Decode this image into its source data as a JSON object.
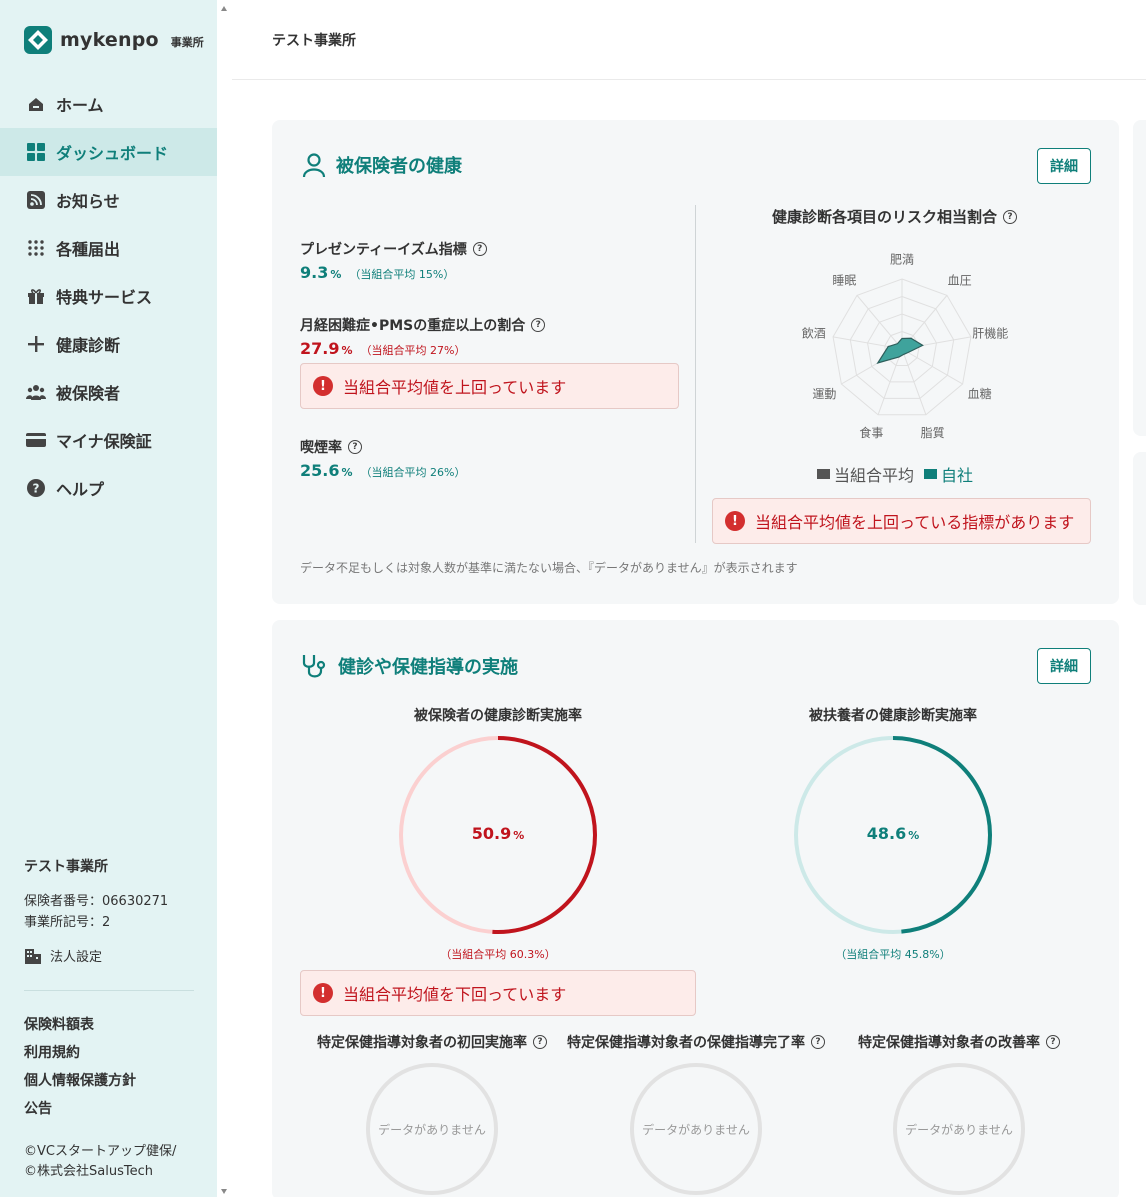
{
  "brand": {
    "name": "mykenpo",
    "suffix": "事業所"
  },
  "sidebar": {
    "items": [
      {
        "label": "ホーム",
        "icon": "home-icon"
      },
      {
        "label": "ダッシュボード",
        "icon": "dashboard-icon",
        "active": true
      },
      {
        "label": "お知らせ",
        "icon": "rss-icon"
      },
      {
        "label": "各種届出",
        "icon": "grid-dots-icon"
      },
      {
        "label": "特典サービス",
        "icon": "gift-icon"
      },
      {
        "label": "健康診断",
        "icon": "plus-icon"
      },
      {
        "label": "被保険者",
        "icon": "people-icon"
      },
      {
        "label": "マイナ保険証",
        "icon": "card-icon"
      },
      {
        "label": "ヘルプ",
        "icon": "help-icon"
      }
    ],
    "office_name": "テスト事業所",
    "insurer_number": "保険者番号：06630271",
    "office_code": "事業所記号：2",
    "corp_settings": "法人設定",
    "links": [
      "保険料額表",
      "利用規約",
      "個人情報保護方針",
      "公告"
    ],
    "copyright": [
      "©VCスタートアップ健保/",
      "©株式会社SalusTech"
    ]
  },
  "header": {
    "title": "テスト事業所"
  },
  "health": {
    "title": "被保険者の健康",
    "detail_label": "詳細",
    "metrics": [
      {
        "label": "プレゼンティーイズム指標",
        "value": "9.3",
        "unit": "%",
        "avg": "（当組合平均 15%）",
        "status": "ok"
      },
      {
        "label": "月経困難症•PMSの重症以上の割合",
        "value": "27.9",
        "unit": "%",
        "avg": "（当組合平均 27%）",
        "status": "over"
      },
      {
        "label": "喫煙率",
        "value": "25.6",
        "unit": "%",
        "avg": "（当組合平均 26%）",
        "status": "ok"
      }
    ],
    "pms_alert": "当組合平均値を上回っています",
    "radar": {
      "title": "健康診断各項目のリスク相当割合",
      "axes": [
        "肥満",
        "血圧",
        "肝機能",
        "血糖",
        "脂質",
        "食事",
        "運動",
        "飲酒",
        "睡眠"
      ],
      "company_values": [
        0.15,
        0.2,
        0.3,
        0.1,
        0.08,
        0.12,
        0.4,
        0.2,
        0.1
      ],
      "legend": [
        {
          "label": "当組合平均",
          "color": "#555555"
        },
        {
          "label": "自社",
          "color": "#0f7f7a"
        }
      ],
      "alert": "当組合平均値を上回っている指標があります"
    },
    "note": "データ不足もしくは対象人数が基準に満たない場合、『データがありません』が表示されます"
  },
  "checkup": {
    "title": "健診や保健指導の実施",
    "detail_label": "詳細",
    "insured": {
      "title": "被保険者の健康診断実施率",
      "value": "50.9",
      "unit": "%",
      "fraction": 0.509,
      "avg": "（当組合平均 60.3%）",
      "color": "#c0141d",
      "track": "#fbd0d0"
    },
    "dependents": {
      "title": "被扶養者の健康診断実施率",
      "value": "48.6",
      "unit": "%",
      "fraction": 0.486,
      "avg": "（当組合平均 45.8%）",
      "color": "#0f7f7a",
      "track": "#cde9e8"
    },
    "insured_alert": "当組合平均値を下回っています",
    "guidance": [
      {
        "title": "特定保健指導対象者の初回実施率",
        "empty": "データがありません"
      },
      {
        "title": "特定保健指導対象者の保健指導完了率",
        "empty": "データがありません"
      },
      {
        "title": "特定保健指導対象者の改善率",
        "empty": "データがありません"
      }
    ]
  }
}
